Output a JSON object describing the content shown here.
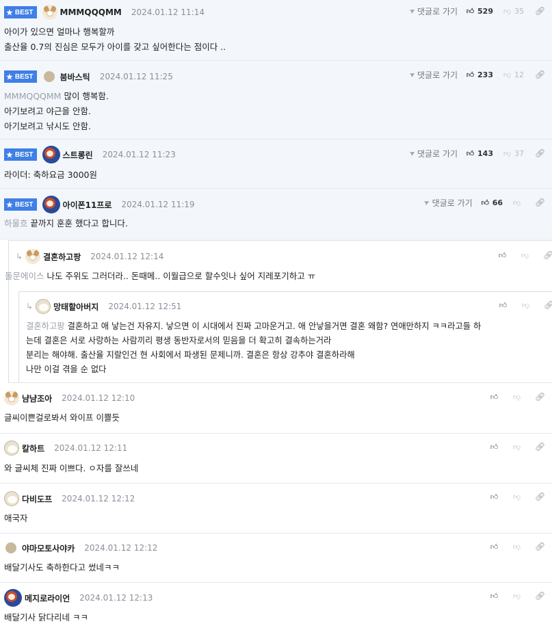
{
  "ui": {
    "best_label": "BEST",
    "reply_label": "댓글로 가기"
  },
  "comments": [
    {
      "best": true,
      "nick": "MMMQQQMM",
      "date": "2024.01.12 11:14",
      "up": "529",
      "down": "35",
      "lines": [
        {
          "mention": "",
          "text": "아이가 있으면 얼마나 행복할까"
        },
        {
          "mention": "",
          "text": "출산율 0.7의 진심은 모두가 아이를 갖고 싶어한다는 점이다 .."
        }
      ]
    },
    {
      "best": true,
      "nick": "붐바스틱",
      "date": "2024.01.12 11:25",
      "up": "233",
      "down": "12",
      "lines": [
        {
          "mention": "MMMQQQMM",
          "text": "많이 행복함."
        },
        {
          "mention": "",
          "text": "아기보려고 야근을 안함."
        },
        {
          "mention": "",
          "text": "아기보려고 낚시도 안함."
        }
      ]
    },
    {
      "best": true,
      "nick": "스트롱린",
      "date": "2024.01.12 11:23",
      "up": "143",
      "down": "37",
      "lines": [
        {
          "mention": "",
          "text": "라이더: 축하요금 3000원"
        }
      ]
    },
    {
      "best": true,
      "nick": "아이폰11프로",
      "date": "2024.01.12 11:19",
      "up": "66",
      "down": "",
      "lines": [
        {
          "mention": "하울흐",
          "text": "끝까지 훈훈 했다고 합니다."
        }
      ]
    },
    {
      "best": false,
      "nick": "결혼하고팡",
      "date": "2024.01.12 12:14",
      "lines": [
        {
          "mention": "돌문에이스",
          "text": "나도 주위도 그러더라.. 돈때메.. 이월급으로 할수잇나 싶어 지레포기하고 ㅠ"
        }
      ]
    },
    {
      "best": false,
      "nick": "망태할아버지",
      "date": "2024.01.12 12:51",
      "lines": [
        {
          "mention": "결혼하고팡",
          "text": "결혼하고 애 낳는건 자유지. 낳으면 이 시대에서 진짜 고마운거고. 애 안낳을거면 결혼 왜함? 연애만하지 ㅋㅋ라고들 하"
        },
        {
          "mention": "",
          "text": "는데 결혼은 서로 사랑하는 사람끼리 평생 동반자로서의 믿음을 더 확고히 결속하는거라"
        },
        {
          "mention": "",
          "text": "분리는 해야해. 출산율 지랄인건 현 사회에서 파생된 문제니까. 결혼은 항상 강추야 결혼하라해"
        },
        {
          "mention": "",
          "text": "나만 이걸 겪을 순 없다"
        }
      ]
    },
    {
      "best": false,
      "nick": "냠냠조아",
      "date": "2024.01.12 12:10",
      "lines": [
        {
          "mention": "",
          "text": "글씨이쁜걸로봐서 와이프 이쁠듯"
        }
      ]
    },
    {
      "best": false,
      "nick": "칼하트",
      "date": "2024.01.12 12:11",
      "lines": [
        {
          "mention": "",
          "text": "와 글씨체 진짜 이쁘다. ㅇ자를 잘쓰네"
        }
      ]
    },
    {
      "best": false,
      "nick": "다비도프",
      "date": "2024.01.12 12:12",
      "lines": [
        {
          "mention": "",
          "text": "애국자"
        }
      ]
    },
    {
      "best": false,
      "nick": "야마모토사야카",
      "date": "2024.01.12 12:12",
      "lines": [
        {
          "mention": "",
          "text": "배달기사도 축하한다고 썼네ㅋㅋ"
        }
      ]
    },
    {
      "best": false,
      "nick": "메지로라이언",
      "date": "2024.01.12 12:13",
      "lines": [
        {
          "mention": "",
          "text": "배달기사 닭다리네 ㅋㅋ"
        }
      ]
    }
  ]
}
